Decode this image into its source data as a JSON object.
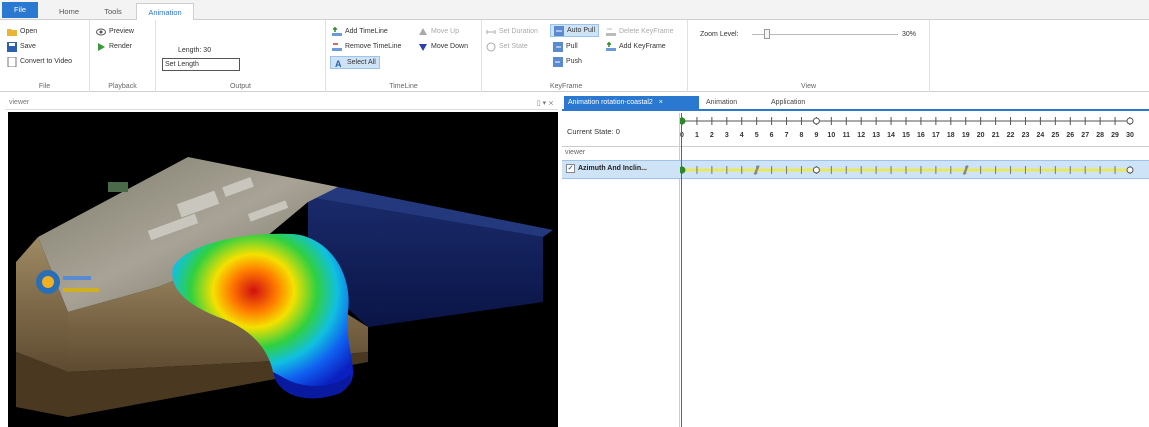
{
  "tabs": {
    "file": "File",
    "home": "Home",
    "tools": "Tools",
    "animation": "Animation"
  },
  "ribbon": {
    "file_group": {
      "label": "File",
      "open": "Open",
      "save": "Save",
      "convert": "Convert to Video"
    },
    "playback_group": {
      "label": "Playback",
      "preview": "Preview",
      "render": "Render"
    },
    "output_group": {
      "label": "Output",
      "length_label": "Length: 30",
      "set_length": "Set Length"
    },
    "timeline_group": {
      "label": "TimeLine",
      "add_timeline": "Add TimeLine",
      "remove_timeline": "Remove TimeLine",
      "select_all": "Select All",
      "move_up": "Move Up",
      "move_down": "Move Down"
    },
    "keyframe_group": {
      "label": "KeyFrame",
      "set_duration": "Set Duration",
      "set_state": "Set State",
      "auto_pull": "Auto Pull",
      "pull": "Pull",
      "push": "Push",
      "delete_keyframe": "Delete KeyFrame",
      "add_keyframe": "Add KeyFrame"
    },
    "view_group": {
      "label": "View",
      "zoom_label": "Zoom Level:",
      "zoom_value": "30%"
    }
  },
  "viewer": {
    "title": "viewer",
    "controls": "▯ ▾ ⨯"
  },
  "right_tabs": {
    "active": "Animation rotation-coastal2",
    "close": "×",
    "tab2": "Animation",
    "tab3": "Application"
  },
  "timeline": {
    "current_state": "Current State: 0",
    "group_name": "viewer",
    "track_name": "Azimuth And Inclin...",
    "frames": [
      "0",
      "1",
      "2",
      "3",
      "4",
      "5",
      "6",
      "7",
      "8",
      "9",
      "10",
      "11",
      "12",
      "13",
      "14",
      "15",
      "16",
      "17",
      "18",
      "19",
      "20",
      "21",
      "22",
      "23",
      "24",
      "25",
      "26",
      "27",
      "28",
      "29",
      "30"
    ]
  },
  "colors": {
    "accent": "#2b78d0",
    "selection": "#cfe3f7",
    "keyline": "#e8e85a"
  }
}
